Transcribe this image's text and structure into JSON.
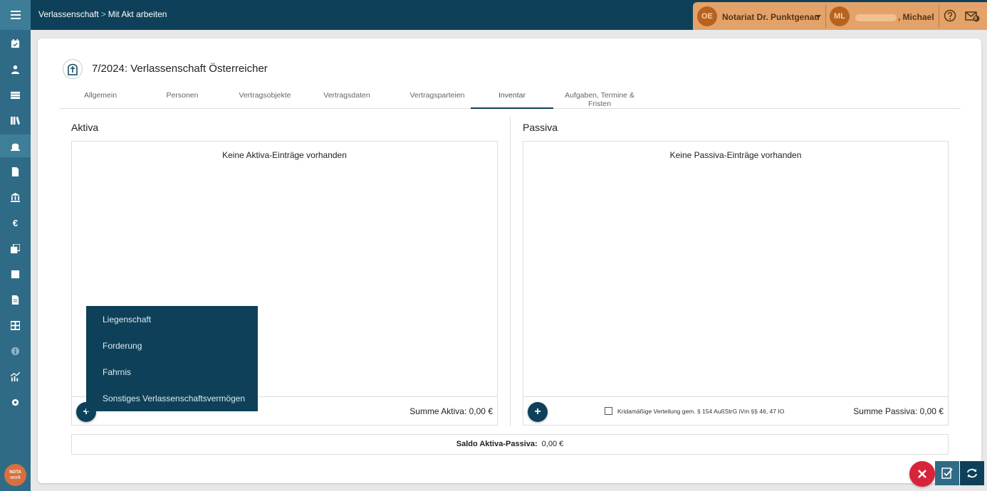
{
  "breadcrumb": {
    "section": "Verlassenschaft",
    "separator": ">",
    "current": "Mit Akt arbeiten"
  },
  "header": {
    "office_initials": "OE",
    "office_name": "Notariat Dr. Punktgenau",
    "user_initials": "ML",
    "user_name": ", Michael",
    "mail_badge": "0"
  },
  "page": {
    "title": "7/2024: Verlassenschaft Österreicher"
  },
  "tabs": [
    {
      "label": "Allgemein"
    },
    {
      "label": "Personen"
    },
    {
      "label": "Vertragsobjekte"
    },
    {
      "label": "Vertragsdaten"
    },
    {
      "label": "Vertragsparteien"
    },
    {
      "label": "Inventar"
    },
    {
      "label": "Aufgaben, Termine & Fristen"
    }
  ],
  "aktiva": {
    "title": "Aktiva",
    "empty_text": "Keine Aktiva-Einträge vorhanden",
    "sum_label": "Summe Aktiva: 0,00 €"
  },
  "passiva": {
    "title": "Passiva",
    "empty_text": "Keine Passiva-Einträge vorhanden",
    "sum_label": "Summe Passiva: 0,00 €",
    "checkbox_label": "Kridamäßige Verteilung gem. § 154 AußStrG iVm §§ 46, 47 IO"
  },
  "saldo": {
    "label": "Saldo Aktiva-Passiva:",
    "value": "0,00 €"
  },
  "add_menu": [
    {
      "label": "Liegenschaft"
    },
    {
      "label": "Forderung"
    },
    {
      "label": "Fahrnis"
    },
    {
      "label": "Sonstiges Verlassenschaftsvermögen"
    }
  ],
  "logo": {
    "line1": "NOTA",
    "line2": "work"
  },
  "colors": {
    "primary": "#0e4159",
    "sidebar": "#2f6b86",
    "accent": "#e2a26a",
    "danger": "#d8243a"
  }
}
